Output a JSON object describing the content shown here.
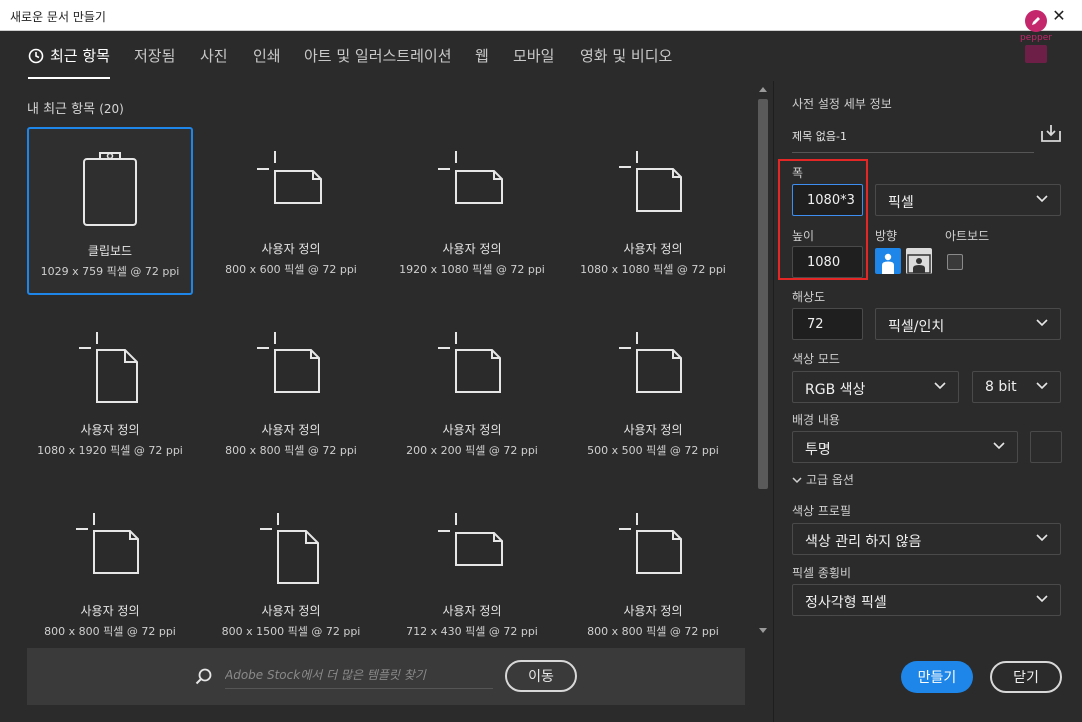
{
  "window": {
    "title": "새로운 문서 만들기",
    "close_glyph": "✕"
  },
  "brand": {
    "name": "pepper",
    "color": "#c4276c"
  },
  "tabs": [
    {
      "label": "최근 항목",
      "active": true
    },
    {
      "label": "저장됨"
    },
    {
      "label": "사진"
    },
    {
      "label": "인쇄"
    },
    {
      "label": "아트 및 일러스트레이션"
    },
    {
      "label": "웹"
    },
    {
      "label": "모바일"
    },
    {
      "label": "영화 및 비디오"
    }
  ],
  "recent": {
    "heading": "내 최근 항목",
    "count": "(20)",
    "items": [
      {
        "name": "클립보드",
        "size": "1029 x 759 픽셀 @ 72 ppi",
        "icon": "clipboard-icon",
        "selected": true
      },
      {
        "name": "사용자 정의",
        "size": "800 x 600 픽셀 @ 72 ppi",
        "icon": "landscape-doc-icon"
      },
      {
        "name": "사용자 정의",
        "size": "1920 x 1080 픽셀 @ 72 ppi",
        "icon": "landscape-doc-icon"
      },
      {
        "name": "사용자 정의",
        "size": "1080 x 1080 픽셀 @ 72 ppi",
        "icon": "square-doc-icon"
      },
      {
        "name": "사용자 정의",
        "size": "1080 x 1920 픽셀 @ 72 ppi",
        "icon": "portrait-doc-icon"
      },
      {
        "name": "사용자 정의",
        "size": "800 x 800 픽셀 @ 72 ppi",
        "icon": "square-doc-icon"
      },
      {
        "name": "사용자 정의",
        "size": "200 x 200 픽셀 @ 72 ppi",
        "icon": "square-doc-icon"
      },
      {
        "name": "사용자 정의",
        "size": "500 x 500 픽셀 @ 72 ppi",
        "icon": "square-doc-icon"
      },
      {
        "name": "사용자 정의",
        "size": "800 x 800 픽셀 @ 72 ppi",
        "icon": "square-doc-icon"
      },
      {
        "name": "사용자 정의",
        "size": "800 x 1500 픽셀 @ 72 ppi",
        "icon": "portrait-doc-icon"
      },
      {
        "name": "사용자 정의",
        "size": "712 x 430 픽셀 @ 72 ppi",
        "icon": "landscape-doc-icon"
      },
      {
        "name": "사용자 정의",
        "size": "800 x 800 픽셀 @ 72 ppi",
        "icon": "square-doc-icon"
      }
    ]
  },
  "search": {
    "placeholder": "Adobe Stock에서 더 많은 템플릿 찾기",
    "go_label": "이동"
  },
  "preset": {
    "heading": "사전 설정 세부 정보",
    "doc_name": "제목 없음-1",
    "width_label": "폭",
    "width_value": "1080*3",
    "unit_value": "픽셀",
    "height_label": "높이",
    "height_value": "1080",
    "orientation_label": "방향",
    "artboard_label": "아트보드",
    "resolution_label": "해상도",
    "resolution_value": "72",
    "resolution_unit": "픽셀/인치",
    "color_mode_label": "색상 모드",
    "color_mode_value": "RGB 색상",
    "bit_depth_value": "8 bit",
    "background_label": "배경 내용",
    "background_value": "투명",
    "advanced_label": "고급 옵션",
    "color_profile_label": "색상 프로필",
    "color_profile_value": "색상 관리 하지 않음",
    "pixel_aspect_label": "픽셀 종횡비",
    "pixel_aspect_value": "정사각형 픽셀"
  },
  "actions": {
    "create_label": "만들기",
    "close_label": "닫기"
  },
  "colors": {
    "accent": "#1d86e8",
    "highlight": "#e32626",
    "background": "#2b2b2b"
  }
}
